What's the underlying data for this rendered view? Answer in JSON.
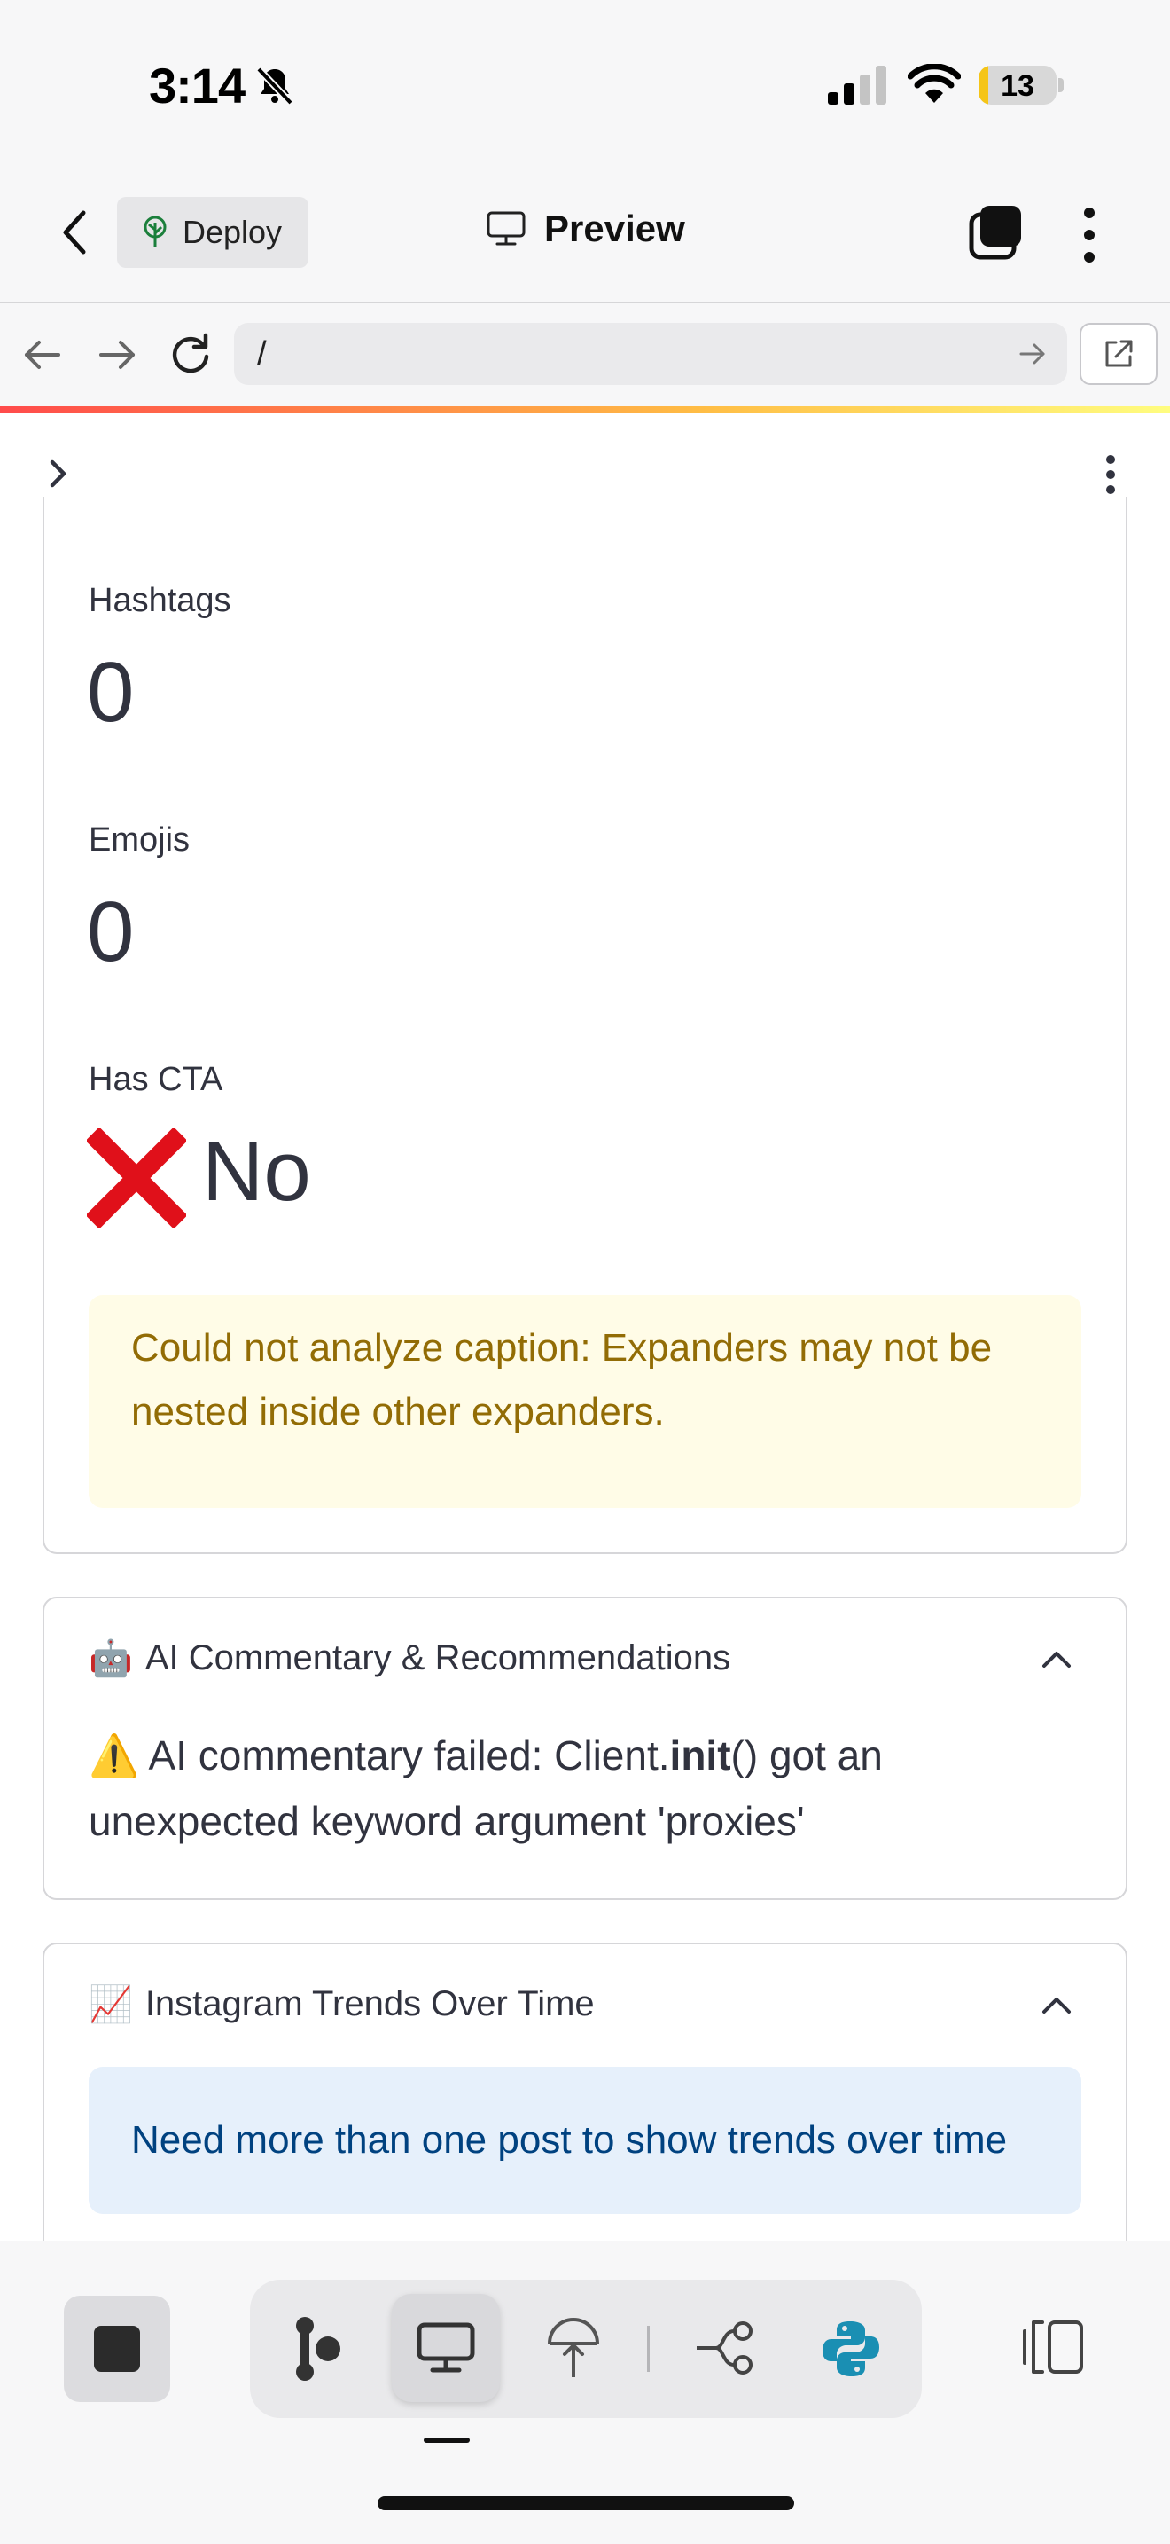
{
  "status_bar": {
    "time": "3:14",
    "battery_level": "13",
    "battery_fraction": 0.13
  },
  "header": {
    "deploy_label": "Deploy",
    "title": "Preview"
  },
  "browser": {
    "url": "/"
  },
  "metrics": [
    {
      "label": "Hashtags",
      "value": "0"
    },
    {
      "label": "Emojis",
      "value": "0"
    },
    {
      "label": "Has CTA",
      "value": "No",
      "icon": "cross-mark-icon"
    }
  ],
  "warning": {
    "text": "Could not analyze caption: Expanders may not be nested inside other expanders."
  },
  "ai_expander": {
    "emoji": "🤖",
    "title": "AI Commentary & Recommendations",
    "error_emoji": "⚠️",
    "error_prefix": "AI commentary failed: Client.",
    "error_bold": "init",
    "error_suffix": "() got an unexpected keyword argument 'proxies'"
  },
  "trends_expander": {
    "emoji": "📈",
    "title": "Instagram Trends Over Time",
    "info": "Need more than one post to show trends over time"
  },
  "colors": {
    "warning_bg": "#fffce7",
    "warning_text": "#926c05",
    "info_bg": "#e6f0fb",
    "info_text": "#004280",
    "python_blue": "#1a8fb3"
  }
}
